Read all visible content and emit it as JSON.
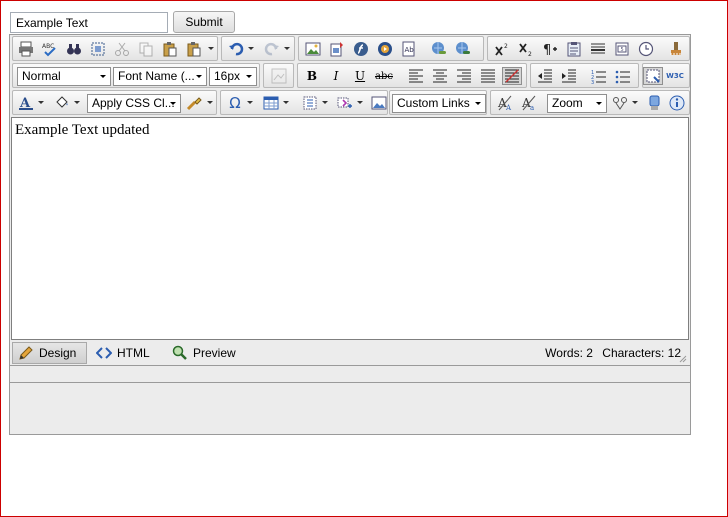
{
  "form": {
    "text_value": "Example Text",
    "submit_label": "Submit"
  },
  "toolbar": {
    "row1_groups": [
      [
        "print-icon",
        "spell-check-icon",
        "find-replace-icon",
        "select-all-icon",
        "cut-icon",
        "copy-icon",
        "paste-icon",
        "paste-options-icon"
      ],
      [
        "undo-icon",
        "redo-icon"
      ],
      [
        "insert-image-icon",
        "insert-media-icon",
        "flash-icon",
        "media-player-icon",
        "document-manager-icon",
        "insert-link-icon",
        "remove-link-icon"
      ],
      [
        "superscript-icon",
        "subscript-icon",
        "show-paragraphs-icon",
        "template-manager-icon",
        "horizontal-rule-icon",
        "form-element-icon",
        "insert-date-icon",
        "format-stripper-icon"
      ]
    ],
    "format_value": "Normal",
    "font_name_value": "Font Name (...",
    "font_size_value": "16px",
    "css_class_value": "Apply CSS Cl...",
    "custom_links_value": "Custom Links",
    "zoom_value": "Zoom",
    "bold_glyph": "B",
    "italic_glyph": "I",
    "underline_glyph": "U",
    "strike_glyph": "abc",
    "symbol_glyph": "Ω",
    "w3c_glyph": "W3C"
  },
  "content": {
    "text": "Example Text updated"
  },
  "modes": {
    "design": "Design",
    "html": "HTML",
    "preview": "Preview"
  },
  "status": {
    "words": "Words: 2",
    "characters": "Characters: 12"
  },
  "colors": {
    "page_border": "#cc0000",
    "toolbar_bg": "#ececec",
    "icon_blue": "#3d5d8c"
  }
}
